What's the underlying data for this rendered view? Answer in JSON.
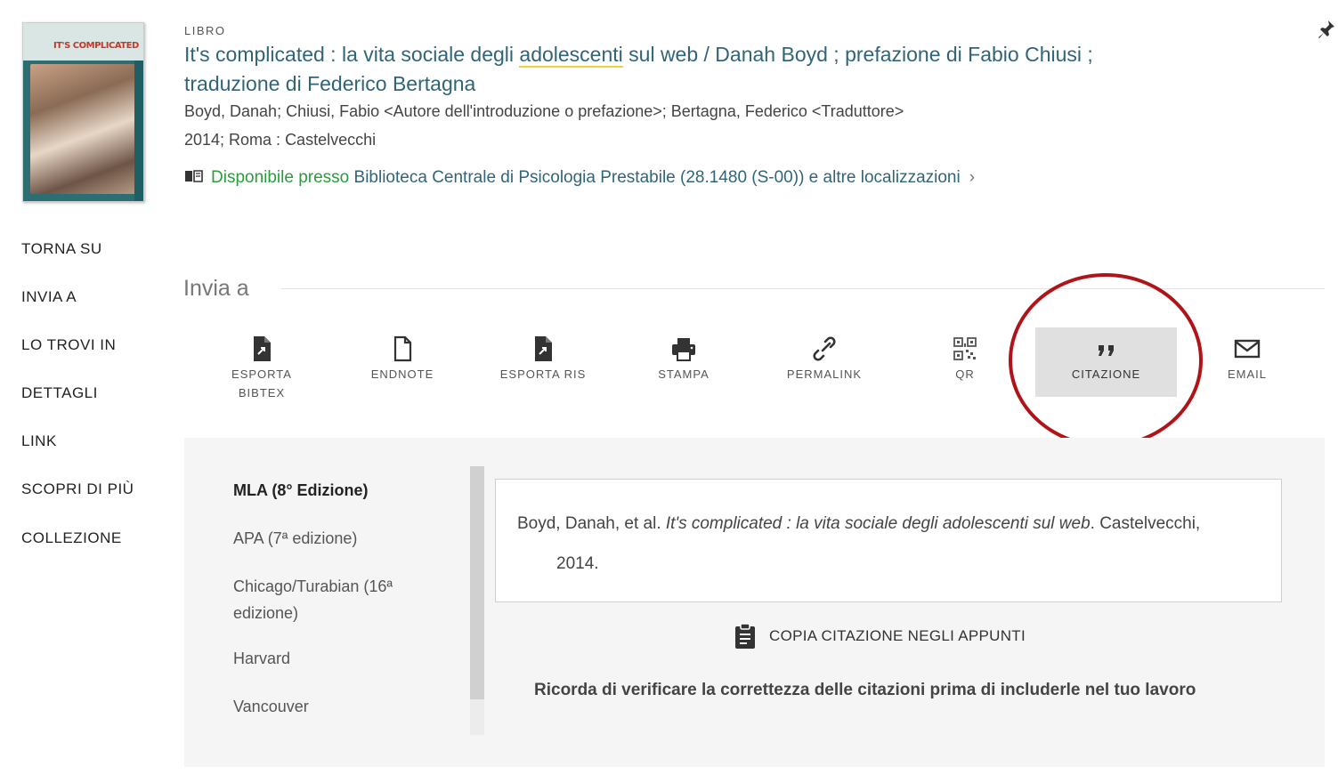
{
  "record": {
    "type": "LIBRO",
    "title_part1": "It's complicated : la vita sociale degli ",
    "title_highlight": "adolescenti",
    "title_part2": " sul web / Danah Boyd ; prefazione di Fabio Chiusi ; traduzione di Federico Bertagna",
    "authors": "Boyd, Danah; Chiusi, Fabio <Autore dell'introduzione o prefazione>; Bertagna, Federico <Traduttore>",
    "publication": "2014; Roma : Castelvecchi",
    "availability_status": "Disponibile presso",
    "availability_location": "Biblioteca Centrale di Psicologia  Prestabile (28.1480 (S-00)) e altre localizzazioni",
    "availability_chevron": "›",
    "cover_title": "IT'S COMPLICATED"
  },
  "nav": [
    "TORNA SU",
    "INVIA A",
    "LO TROVI IN",
    "DETTAGLI",
    "LINK",
    "SCOPRI DI PIÙ",
    "COLLEZIONE"
  ],
  "send_to": {
    "title": "Invia a",
    "actions": [
      {
        "label_line1": "ESPORTA",
        "label_line2": "BIBTEX",
        "icon": "file-export-icon"
      },
      {
        "label_line1": "ENDNOTE",
        "label_line2": "",
        "icon": "file-icon"
      },
      {
        "label_line1": "ESPORTA RIS",
        "label_line2": "",
        "icon": "file-export-icon"
      },
      {
        "label_line1": "STAMPA",
        "label_line2": "",
        "icon": "printer-icon"
      },
      {
        "label_line1": "PERMALINK",
        "label_line2": "",
        "icon": "link-icon"
      },
      {
        "label_line1": "QR",
        "label_line2": "",
        "icon": "qr-code-icon"
      },
      {
        "label_line1": "CITAZIONE",
        "label_line2": "",
        "icon": "quote-icon"
      },
      {
        "label_line1": "EMAIL",
        "label_line2": "",
        "icon": "email-icon"
      }
    ],
    "active_action": "CITAZIONE"
  },
  "citation": {
    "styles": [
      "MLA (8° Edizione)",
      "APA (7ª edizione)",
      "Chicago/Turabian (16ª edizione)",
      "Harvard",
      "Vancouver"
    ],
    "selected_style": "MLA (8° Edizione)",
    "text_prefix": "Boyd, Danah, et al. ",
    "text_italic": "It's complicated : la vita sociale degli adolescenti sul web",
    "text_suffix": ". Castelvecchi,",
    "text_line2": "2014.",
    "copy_label": "COPIA CITAZIONE NEGLI APPUNTI",
    "warning": "Ricorda di verificare la correttezza delle citazioni prima di includerle nel tuo lavoro"
  },
  "colors": {
    "title": "#306578",
    "available": "#2a9d3c",
    "highlight_circle": "#b01419",
    "underline": "#f2d13a"
  }
}
